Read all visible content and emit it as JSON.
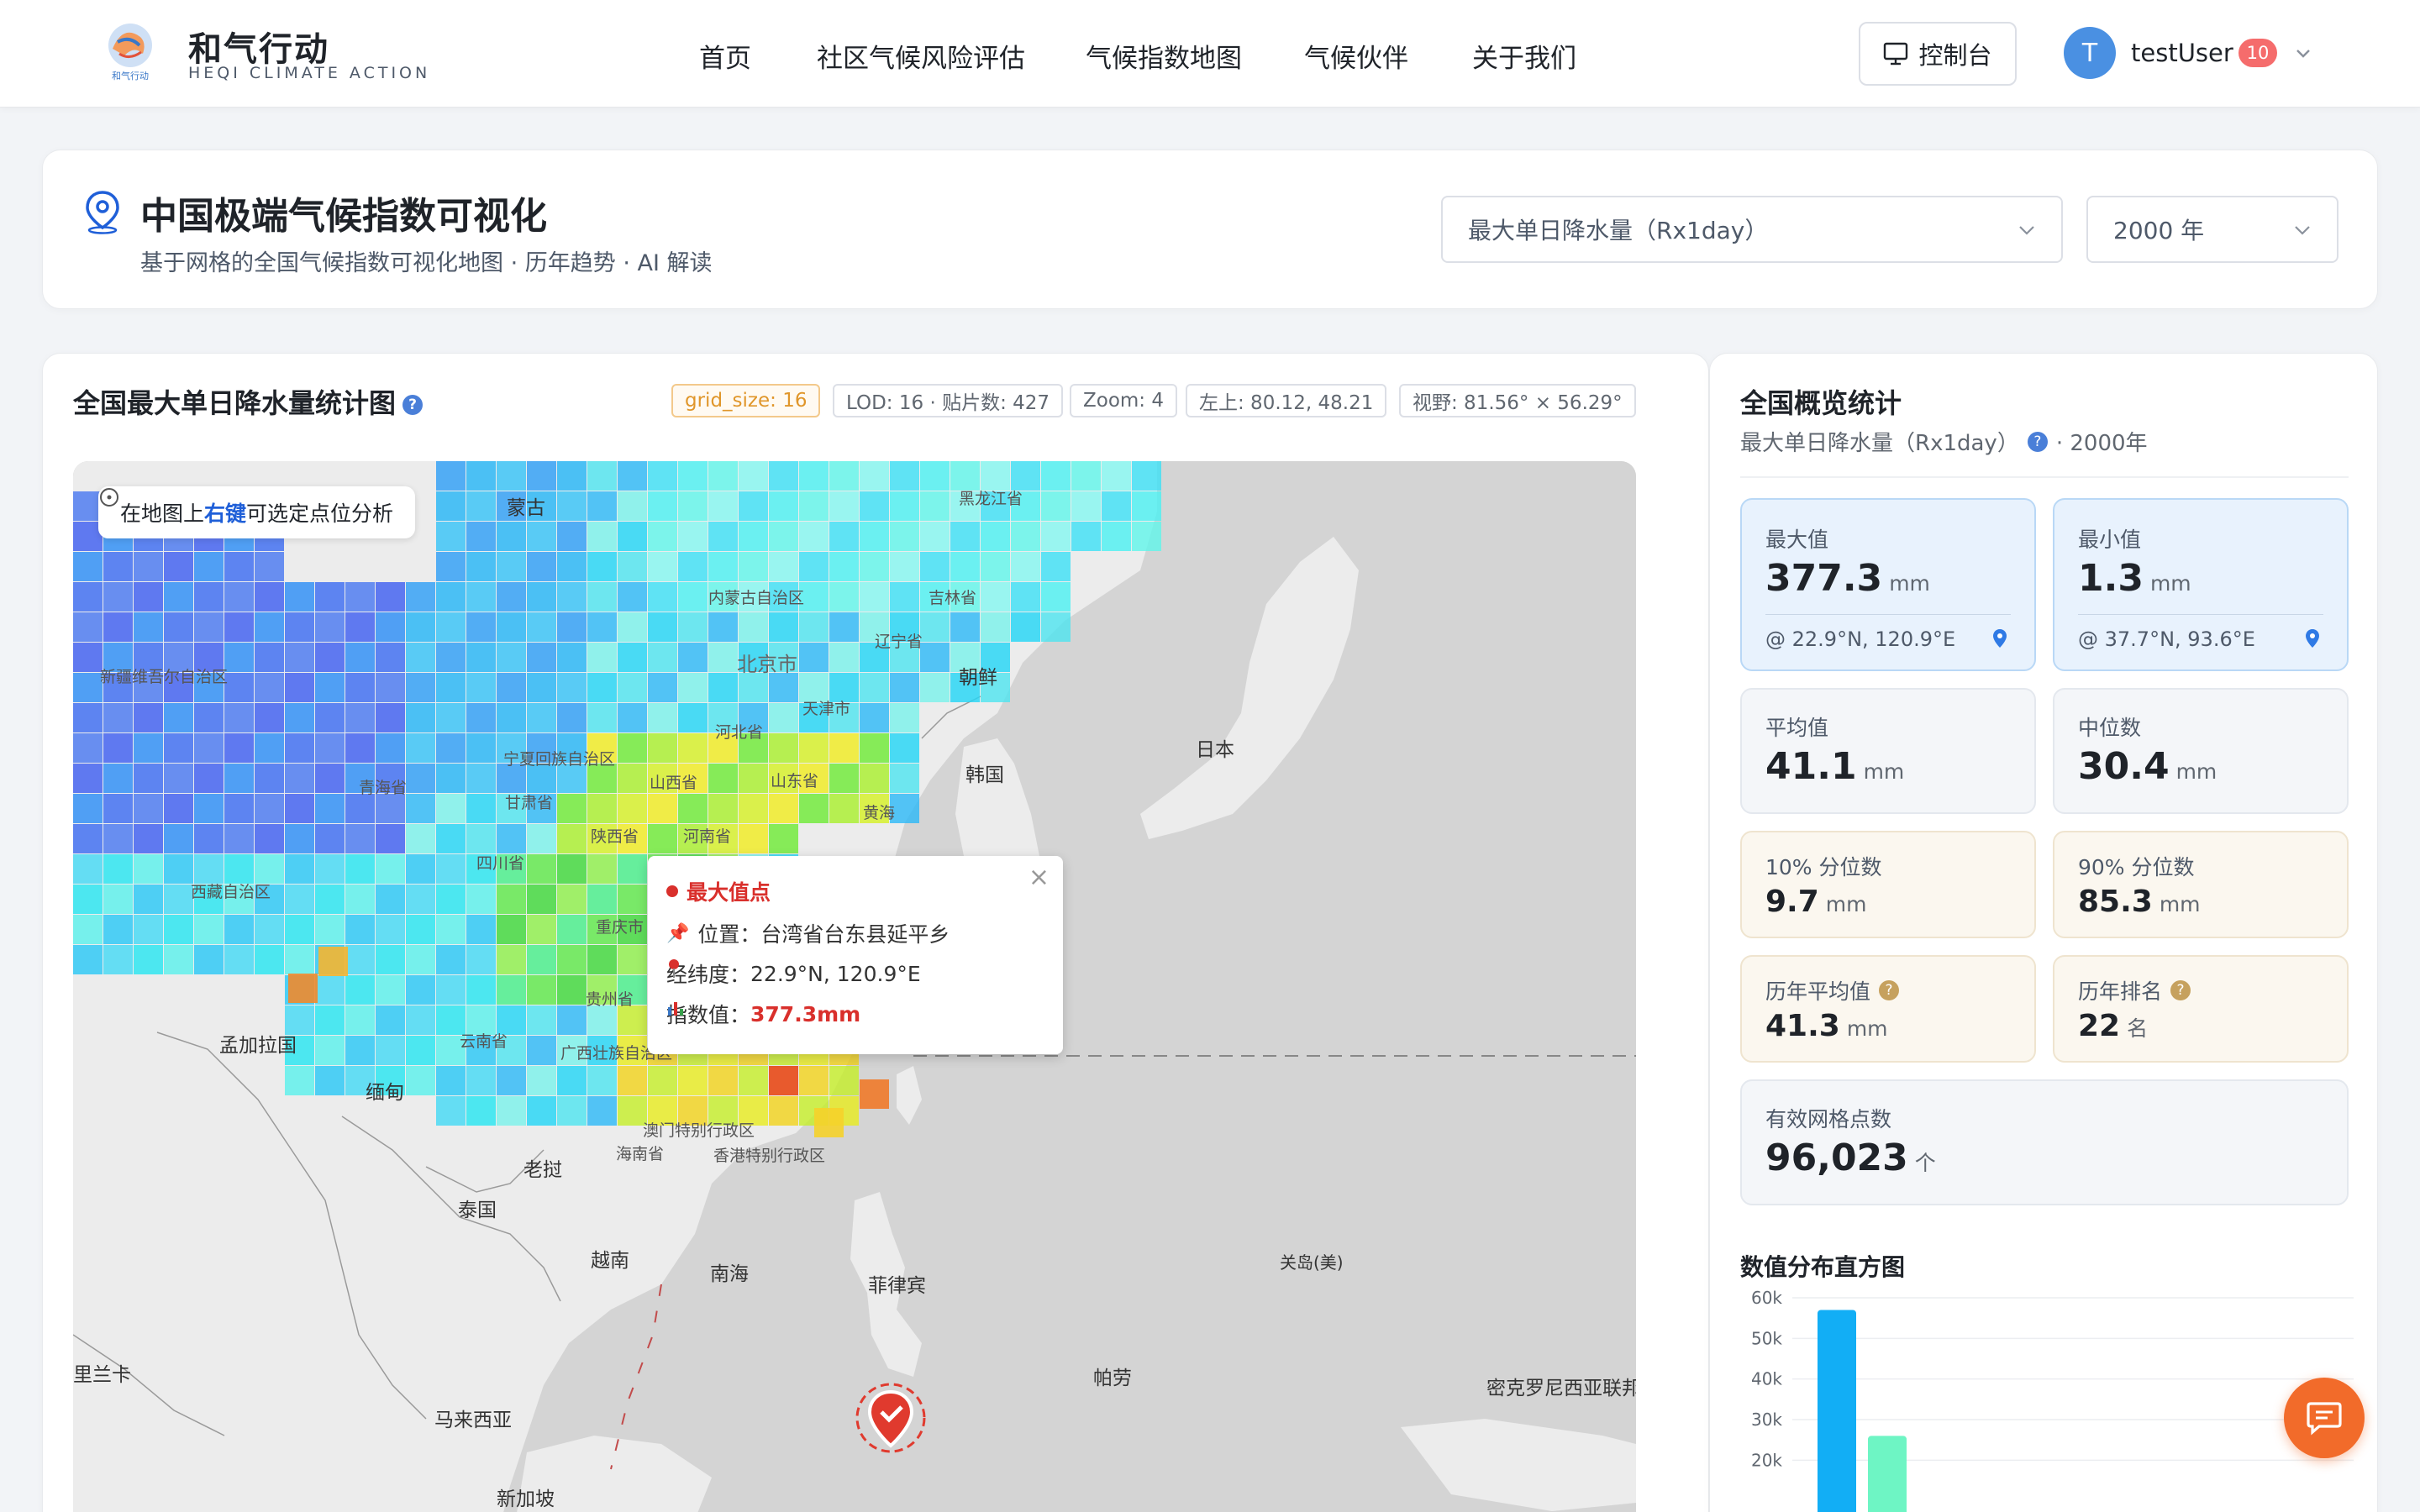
{
  "brand": {
    "name_cn": "和气行动",
    "name_en": "HEQI CLIMATE ACTION",
    "logo_text": "和气行动"
  },
  "nav": {
    "items": [
      "首页",
      "社区气候风险评估",
      "气候指数地图",
      "气候伙伴",
      "关于我们"
    ]
  },
  "header": {
    "console_label": "控制台",
    "avatar_initial": "T",
    "username": "testUser",
    "notification_count": "10"
  },
  "page": {
    "title": "中国极端气候指数可视化",
    "subtitle": "基于网格的全国气候指数可视化地图 · 历年趋势 · AI 解读",
    "index_select": "最大单日降水量（Rx1day）",
    "year_select": "2000 年"
  },
  "map_panel": {
    "title": "全国最大单日降水量统计图",
    "tags": {
      "grid_size": "grid_size: 16",
      "lod": "LOD: 16 · 贴片数: 427",
      "zoom": "Zoom: 4",
      "top_left": "左上: 80.12, 48.21",
      "view": "视野: 81.56° × 56.29°"
    },
    "hint_prefix": "在地图上",
    "hint_highlight": "右键",
    "hint_suffix": "可选定点位分析",
    "labels": {
      "mongolia": "蒙古",
      "heilongjiang": "黑龙江省",
      "neimenggu": "内蒙古自治区",
      "jilin": "吉林省",
      "liaoning": "辽宁省",
      "beijing": "北京市",
      "tianjin": "天津市",
      "hebei": "河北省",
      "shanxi": "山西省",
      "shandong": "山东省",
      "henan": "河南省",
      "ningxia": "宁夏回族自治区",
      "gansu": "甘肃省",
      "qinghai": "青海省",
      "xinjiang": "新疆维吾尔自治区",
      "xizang": "西藏自治区",
      "sichuan": "四川省",
      "shaanxi": "陕西省",
      "chongqing": "重庆市",
      "guizhou": "贵州省",
      "yunnan": "云南省",
      "guangxi": "广西壮族自治区",
      "hainan": "海南省",
      "macau": "澳门特别行政区",
      "hongkong": "香港特别行政区",
      "north_korea": "朝鲜",
      "korea": "韩国",
      "japan": "日本",
      "yellow_sea": "黄海",
      "bangladesh": "孟加拉国",
      "myanmar": "缅甸",
      "laos": "老挝",
      "thailand": "泰国",
      "vietnam": "越南",
      "south_sea": "南海",
      "philippines": "菲律宾",
      "guam": "关岛(美)",
      "palau": "帕劳",
      "micronesia": "密克罗尼西亚联邦",
      "srilanka": "里兰卡",
      "malaysia": "马来西亚",
      "singapore": "新加坡"
    },
    "popup": {
      "title": "最大值点",
      "location_label": "位置：",
      "location_value": "台湾省台东县延平乡",
      "coord_label": "经纬度：",
      "coord_value": "22.9°N, 120.9°E",
      "value_label": "指数值：",
      "value_value": "377.3mm",
      "close": "×"
    }
  },
  "stats": {
    "title": "全国概览统计",
    "subtitle_index": "最大单日降水量（Rx1day）",
    "subtitle_year": "· 2000年",
    "max": {
      "label": "最大值",
      "value": "377.3",
      "unit": "mm",
      "loc": "@ 22.9°N, 120.9°E"
    },
    "min": {
      "label": "最小值",
      "value": "1.3",
      "unit": "mm",
      "loc": "@ 37.7°N, 93.6°E"
    },
    "mean": {
      "label": "平均值",
      "value": "41.1",
      "unit": "mm"
    },
    "median": {
      "label": "中位数",
      "value": "30.4",
      "unit": "mm"
    },
    "p10": {
      "label": "10% 分位数",
      "value": "9.7",
      "unit": "mm"
    },
    "p90": {
      "label": "90% 分位数",
      "value": "85.3",
      "unit": "mm"
    },
    "hist_mean": {
      "label": "历年平均值",
      "value": "41.3",
      "unit": "mm"
    },
    "rank": {
      "label": "历年排名",
      "value": "22",
      "unit": "名"
    },
    "grid_count": {
      "label": "有效网格点数",
      "value": "96,023",
      "unit": "个"
    },
    "histogram_title": "数值分布直方图"
  },
  "chart_data": {
    "type": "bar",
    "title": "数值分布直方图",
    "ylim": [
      0,
      60000
    ],
    "yticks": [
      "60k",
      "50k",
      "40k",
      "30k",
      "20k"
    ],
    "series": [
      {
        "values": [
          57000,
          26000
        ]
      }
    ],
    "colors": [
      "#12aef5",
      "#6ef5c4"
    ]
  },
  "colors": {
    "accent": "#1f5fd8",
    "max_red": "#d9302c",
    "fab": "#f26b2a",
    "badge": "#f56c6c"
  }
}
